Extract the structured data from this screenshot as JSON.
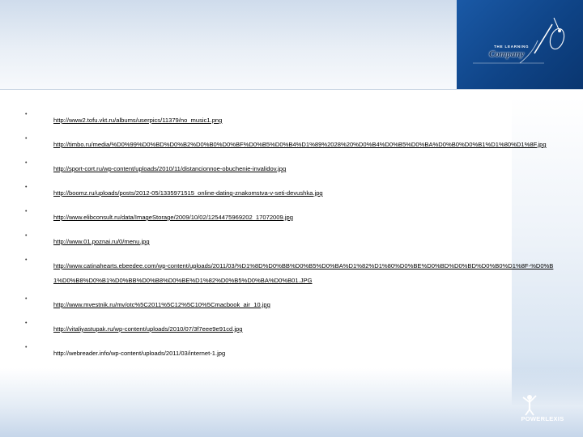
{
  "logo": {
    "tagline": "THE LEARNING",
    "name": "Company"
  },
  "footer_logo": {
    "name": "POWERLEXIS"
  },
  "links": [
    {
      "text": "http://www2.tofu.vkt.ru/albums/userpics/11379/no_music1.png"
    },
    {
      "text": "http://timbo.ru/media/%D0%99%D0%BD%D0%B2%D0%B0%D0%BF%D0%B5%D0%B4%D1%89%2028%20%D0%B4%D0%B5%D0%BA%D0%B0%D0%B1%D1%80%D1%8F.jpg"
    },
    {
      "text": "http://sport-cort.ru/wp-content/uploads/2010/11/distancionnoe-obuchenie-invalidov.jpg"
    },
    {
      "text": "http://boomz.ru/uploads/posts/2012-05/1335971515_online-dating-znakomstva-v-seti-devushka.jpg"
    },
    {
      "text": "http://www.elibconsult.ru/data/ImageStorage/2009/10/02/1254475969202_17072009.jpg"
    },
    {
      "text": "http://www.01.poznai.ru/0/menu.jpg"
    },
    {
      "text": "http://www.catinahearts.ebeedee.com/wp-content/uploads/2011/03/%D1%8D%D0%BB%D0%B5%D0%BA%D1%82%D1%80%D0%BE%D0%BD%D0%BD%D0%B0%D1%8F-%D0%B1%D0%B8%D0%B1%D0%BB%D0%B8%D0%BE%D1%82%D0%B5%D0%BA%D0%B01.JPG"
    },
    {
      "text": "http://www.mvestnik.ru/mv/otc%5C2011%5C12%5C10%5Cmacbook_air_10.jpg"
    },
    {
      "text": "http://vitaliyastupak.ru/wp-content/uploads/2010/07/3f7eee9e91cd.jpg"
    },
    {
      "text": "http://webreader.info/wp-content/uploads/2011/03/internet-1.jpg"
    }
  ],
  "colors": {
    "logo_blue": "#114a8f",
    "band_light": "#dbe6f2",
    "text": "#000000"
  },
  "icons": {
    "logo_mark": "pen-nib-swoosh-icon",
    "footer_mark": "figure-raising-arms-icon"
  }
}
